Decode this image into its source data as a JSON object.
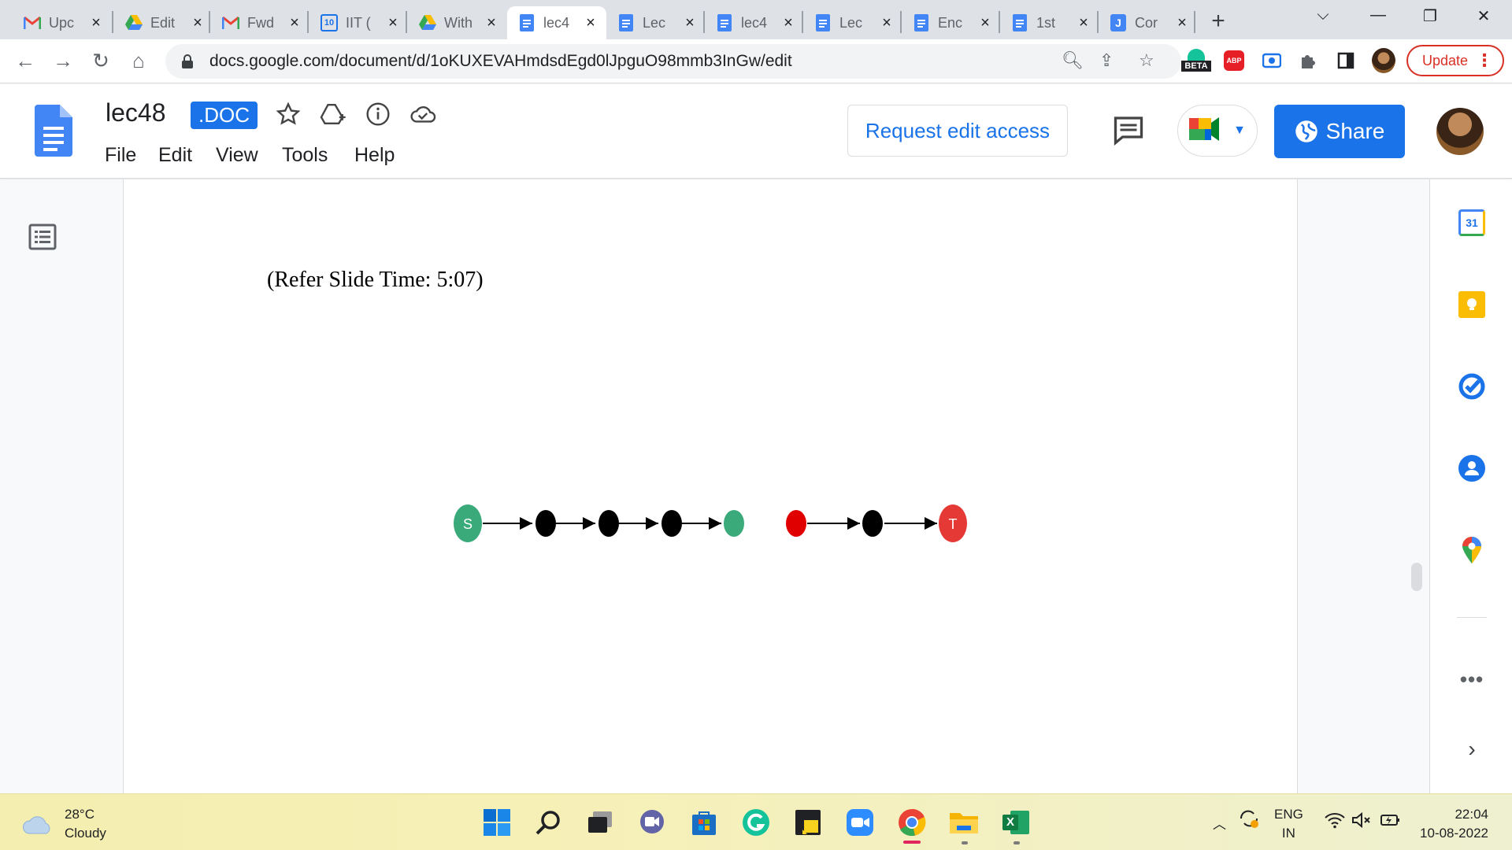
{
  "browser": {
    "tabs": [
      {
        "title": "Upc",
        "icon": "gmail-icon"
      },
      {
        "title": "Edit",
        "icon": "drive-icon"
      },
      {
        "title": "Fwd",
        "icon": "gmail-icon"
      },
      {
        "title": "IIT (",
        "icon": "calendar-icon",
        "icon_text": "10"
      },
      {
        "title": "With",
        "icon": "drive-icon"
      },
      {
        "title": "lec4",
        "icon": "docs-icon",
        "active": true
      },
      {
        "title": "Lec",
        "icon": "docs-icon"
      },
      {
        "title": "lec4",
        "icon": "docs-icon"
      },
      {
        "title": "Lec",
        "icon": "docs-icon"
      },
      {
        "title": "Enc",
        "icon": "docs-icon"
      },
      {
        "title": "1st",
        "icon": "docs-icon"
      },
      {
        "title": "Cor",
        "icon": "jamboard-icon",
        "icon_text": "J"
      }
    ],
    "url": "docs.google.com/document/d/1oKUXEVAHmdsdEgd0lJpguO98mmb3InGw/edit",
    "beta_label": "BETA",
    "abp_label": "ABP",
    "update_label": "Update"
  },
  "docs": {
    "title": "lec48",
    "badge": ".DOC",
    "menus": [
      "File",
      "Edit",
      "View",
      "Tools",
      "Help"
    ],
    "request_edit": "Request edit access",
    "share": "Share"
  },
  "document": {
    "slide_ref": "(Refer Slide Time: 5:07)",
    "path_diagram": {
      "node_labels": {
        "start": "S",
        "end": "T"
      },
      "chain_one": [
        "green-S",
        "black",
        "black",
        "black",
        "green"
      ],
      "chain_two": [
        "red",
        "black",
        "red-T"
      ]
    }
  },
  "side_panel": {
    "calendar_text": "31",
    "items": [
      "calendar-icon",
      "keep-icon",
      "tasks-icon",
      "contacts-icon",
      "maps-icon"
    ]
  },
  "taskbar": {
    "temperature": "28°C",
    "condition": "Cloudy",
    "lang_top": "ENG",
    "lang_bottom": "IN",
    "time": "22:04",
    "date": "10-08-2022",
    "excel_letter": "X"
  },
  "colors": {
    "accent_blue": "#1a73e8",
    "node_green": "#3aaa7a",
    "node_red": "#e00000",
    "node_t": "#e53935"
  }
}
